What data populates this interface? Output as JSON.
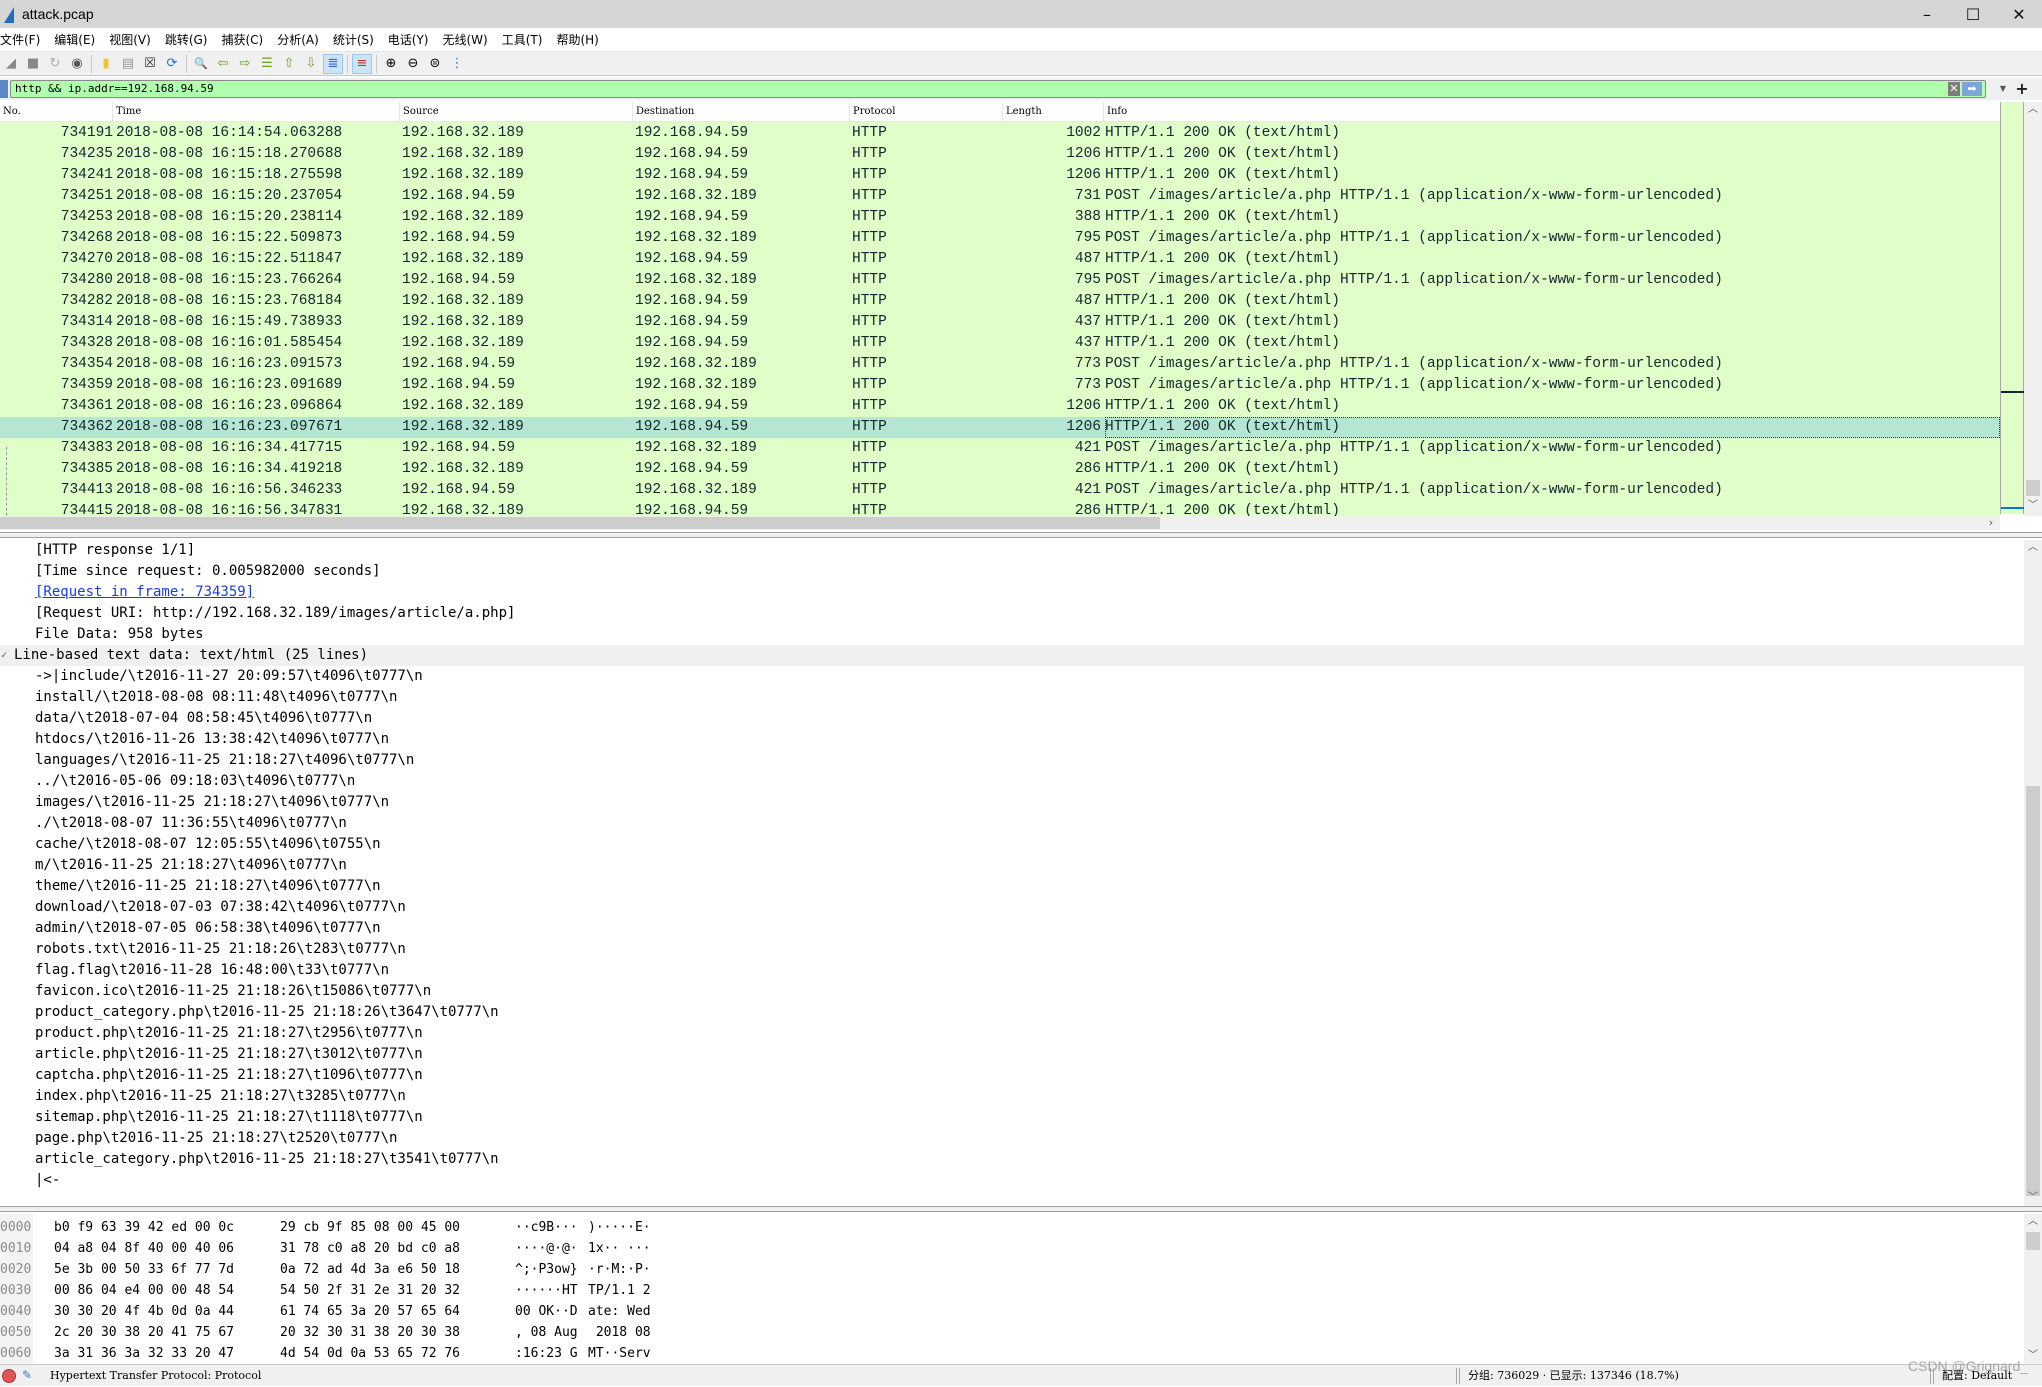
{
  "window": {
    "title": "attack.pcap",
    "controls": {
      "minimize": "–",
      "maximize": "☐",
      "close": "✕"
    }
  },
  "menu": [
    "文件(F)",
    "编辑(E)",
    "视图(V)",
    "跳转(G)",
    "捕获(C)",
    "分析(A)",
    "统计(S)",
    "电话(Y)",
    "无线(W)",
    "工具(T)",
    "帮助(H)"
  ],
  "toolbar": {
    "icons": [
      {
        "name": "start-capture-icon",
        "glyph": "◢"
      },
      {
        "name": "stop-capture-icon",
        "glyph": "■"
      },
      {
        "name": "restart-capture-icon",
        "glyph": "↻"
      },
      {
        "name": "capture-options-icon",
        "glyph": "◉"
      },
      {
        "name": "open-file-icon",
        "glyph": "▮"
      },
      {
        "name": "save-file-icon",
        "glyph": "▤"
      },
      {
        "name": "close-file-icon",
        "glyph": "☒"
      },
      {
        "name": "reload-file-icon",
        "glyph": "⟳"
      },
      {
        "name": "find-packet-icon",
        "glyph": "🔍"
      },
      {
        "name": "go-back-icon",
        "glyph": "⇦"
      },
      {
        "name": "go-forward-icon",
        "glyph": "⇨"
      },
      {
        "name": "go-to-packet-icon",
        "glyph": "☰"
      },
      {
        "name": "go-first-icon",
        "glyph": "⇧"
      },
      {
        "name": "go-last-icon",
        "glyph": "⇩"
      },
      {
        "name": "auto-scroll-icon",
        "glyph": "≣"
      },
      {
        "name": "colorize-icon",
        "glyph": "≡"
      },
      {
        "name": "zoom-in-icon",
        "glyph": "⊕"
      },
      {
        "name": "zoom-out-icon",
        "glyph": "⊖"
      },
      {
        "name": "zoom-reset-icon",
        "glyph": "⊜"
      },
      {
        "name": "resize-columns-icon",
        "glyph": "⋮"
      }
    ]
  },
  "filter": {
    "value": "http && ip.addr==192.168.94.59",
    "clear_glyph": "✕",
    "apply_glyph": "➡",
    "dropdown_glyph": "▼",
    "add_glyph": "+",
    "color": "#afffaf"
  },
  "packet_list": {
    "columns": [
      "No.",
      "Time",
      "Source",
      "Destination",
      "Protocol",
      "Length",
      "Info"
    ],
    "rows": [
      {
        "no": "734191",
        "time": "2018-08-08 16:14:54.063288",
        "src": "192.168.32.189",
        "dst": "192.168.94.59",
        "proto": "HTTP",
        "len": "1002",
        "info": "HTTP/1.1 200 OK  (text/html)"
      },
      {
        "no": "734235",
        "time": "2018-08-08 16:15:18.270688",
        "src": "192.168.32.189",
        "dst": "192.168.94.59",
        "proto": "HTTP",
        "len": "1206",
        "info": "HTTP/1.1 200 OK  (text/html)"
      },
      {
        "no": "734241",
        "time": "2018-08-08 16:15:18.275598",
        "src": "192.168.32.189",
        "dst": "192.168.94.59",
        "proto": "HTTP",
        "len": "1206",
        "info": "HTTP/1.1 200 OK  (text/html)"
      },
      {
        "no": "734251",
        "time": "2018-08-08 16:15:20.237054",
        "src": "192.168.94.59",
        "dst": "192.168.32.189",
        "proto": "HTTP",
        "len": "731",
        "info": "POST /images/article/a.php HTTP/1.1  (application/x-www-form-urlencoded)"
      },
      {
        "no": "734253",
        "time": "2018-08-08 16:15:20.238114",
        "src": "192.168.32.189",
        "dst": "192.168.94.59",
        "proto": "HTTP",
        "len": "388",
        "info": "HTTP/1.1 200 OK  (text/html)"
      },
      {
        "no": "734268",
        "time": "2018-08-08 16:15:22.509873",
        "src": "192.168.94.59",
        "dst": "192.168.32.189",
        "proto": "HTTP",
        "len": "795",
        "info": "POST /images/article/a.php HTTP/1.1  (application/x-www-form-urlencoded)"
      },
      {
        "no": "734270",
        "time": "2018-08-08 16:15:22.511847",
        "src": "192.168.32.189",
        "dst": "192.168.94.59",
        "proto": "HTTP",
        "len": "487",
        "info": "HTTP/1.1 200 OK  (text/html)"
      },
      {
        "no": "734280",
        "time": "2018-08-08 16:15:23.766264",
        "src": "192.168.94.59",
        "dst": "192.168.32.189",
        "proto": "HTTP",
        "len": "795",
        "info": "POST /images/article/a.php HTTP/1.1  (application/x-www-form-urlencoded)"
      },
      {
        "no": "734282",
        "time": "2018-08-08 16:15:23.768184",
        "src": "192.168.32.189",
        "dst": "192.168.94.59",
        "proto": "HTTP",
        "len": "487",
        "info": "HTTP/1.1 200 OK  (text/html)"
      },
      {
        "no": "734314",
        "time": "2018-08-08 16:15:49.738933",
        "src": "192.168.32.189",
        "dst": "192.168.94.59",
        "proto": "HTTP",
        "len": "437",
        "info": "HTTP/1.1 200 OK  (text/html)"
      },
      {
        "no": "734328",
        "time": "2018-08-08 16:16:01.585454",
        "src": "192.168.32.189",
        "dst": "192.168.94.59",
        "proto": "HTTP",
        "len": "437",
        "info": "HTTP/1.1 200 OK  (text/html)"
      },
      {
        "no": "734354",
        "time": "2018-08-08 16:16:23.091573",
        "src": "192.168.94.59",
        "dst": "192.168.32.189",
        "proto": "HTTP",
        "len": "773",
        "info": "POST /images/article/a.php HTTP/1.1  (application/x-www-form-urlencoded)"
      },
      {
        "no": "734359",
        "time": "2018-08-08 16:16:23.091689",
        "src": "192.168.94.59",
        "dst": "192.168.32.189",
        "proto": "HTTP",
        "len": "773",
        "info": "POST /images/article/a.php HTTP/1.1  (application/x-www-form-urlencoded)"
      },
      {
        "no": "734361",
        "time": "2018-08-08 16:16:23.096864",
        "src": "192.168.32.189",
        "dst": "192.168.94.59",
        "proto": "HTTP",
        "len": "1206",
        "info": "HTTP/1.1 200 OK  (text/html)"
      },
      {
        "no": "734362",
        "time": "2018-08-08 16:16:23.097671",
        "src": "192.168.32.189",
        "dst": "192.168.94.59",
        "proto": "HTTP",
        "len": "1206",
        "info": "HTTP/1.1 200 OK  (text/html)",
        "selected": true
      },
      {
        "no": "734383",
        "time": "2018-08-08 16:16:34.417715",
        "src": "192.168.94.59",
        "dst": "192.168.32.189",
        "proto": "HTTP",
        "len": "421",
        "info": "POST /images/article/a.php HTTP/1.1  (application/x-www-form-urlencoded)"
      },
      {
        "no": "734385",
        "time": "2018-08-08 16:16:34.419218",
        "src": "192.168.32.189",
        "dst": "192.168.94.59",
        "proto": "HTTP",
        "len": "286",
        "info": "HTTP/1.1 200 OK  (text/html)"
      },
      {
        "no": "734413",
        "time": "2018-08-08 16:16:56.346233",
        "src": "192.168.94.59",
        "dst": "192.168.32.189",
        "proto": "HTTP",
        "len": "421",
        "info": "POST /images/article/a.php HTTP/1.1  (application/x-www-form-urlencoded)"
      },
      {
        "no": "734415",
        "time": "2018-08-08 16:16:56.347831",
        "src": "192.168.32.189",
        "dst": "192.168.94.59",
        "proto": "HTTP",
        "len": "286",
        "info": "HTTP/1.1 200 OK  (text/html)"
      }
    ],
    "row_color": "#e0ffc8",
    "selected_color": "#b4e6d2"
  },
  "details": {
    "lines": [
      {
        "text": "[HTTP response 1/1]"
      },
      {
        "text": "[Time since request: 0.005982000 seconds]"
      },
      {
        "text": "[Request in frame: 734359]",
        "link": true
      },
      {
        "text": "[Request URI: http://192.168.32.189/images/article/a.php]"
      },
      {
        "text": "File Data: 958 bytes"
      },
      {
        "text": "Line-based text data: text/html (25 lines)",
        "header": true,
        "toggle": "✓"
      },
      {
        "text": "->|include/\\t2016-11-27 20:09:57\\t4096\\t0777\\n"
      },
      {
        "text": "install/\\t2018-08-08 08:11:48\\t4096\\t0777\\n"
      },
      {
        "text": "data/\\t2018-07-04 08:58:45\\t4096\\t0777\\n"
      },
      {
        "text": "htdocs/\\t2016-11-26 13:38:42\\t4096\\t0777\\n"
      },
      {
        "text": "languages/\\t2016-11-25 21:18:27\\t4096\\t0777\\n"
      },
      {
        "text": "../\\t2016-05-06 09:18:03\\t4096\\t0777\\n"
      },
      {
        "text": "images/\\t2016-11-25 21:18:27\\t4096\\t0777\\n"
      },
      {
        "text": "./\\t2018-08-07 11:36:55\\t4096\\t0777\\n"
      },
      {
        "text": "cache/\\t2018-08-07 12:05:55\\t4096\\t0755\\n"
      },
      {
        "text": "m/\\t2016-11-25 21:18:27\\t4096\\t0777\\n"
      },
      {
        "text": "theme/\\t2016-11-25 21:18:27\\t4096\\t0777\\n"
      },
      {
        "text": "download/\\t2018-07-03 07:38:42\\t4096\\t0777\\n"
      },
      {
        "text": "admin/\\t2018-07-05 06:58:38\\t4096\\t0777\\n"
      },
      {
        "text": "robots.txt\\t2016-11-25 21:18:26\\t283\\t0777\\n"
      },
      {
        "text": "flag.flag\\t2016-11-28 16:48:00\\t33\\t0777\\n"
      },
      {
        "text": "favicon.ico\\t2016-11-25 21:18:26\\t15086\\t0777\\n"
      },
      {
        "text": "product_category.php\\t2016-11-25 21:18:26\\t3647\\t0777\\n"
      },
      {
        "text": "product.php\\t2016-11-25 21:18:27\\t2956\\t0777\\n"
      },
      {
        "text": "article.php\\t2016-11-25 21:18:27\\t3012\\t0777\\n"
      },
      {
        "text": "captcha.php\\t2016-11-25 21:18:27\\t1096\\t0777\\n"
      },
      {
        "text": "index.php\\t2016-11-25 21:18:27\\t3285\\t0777\\n"
      },
      {
        "text": "sitemap.php\\t2016-11-25 21:18:27\\t1118\\t0777\\n"
      },
      {
        "text": "page.php\\t2016-11-25 21:18:27\\t2520\\t0777\\n"
      },
      {
        "text": "article_category.php\\t2016-11-25 21:18:27\\t3541\\t0777\\n"
      },
      {
        "text": "|<-"
      }
    ]
  },
  "bytes": {
    "rows": [
      {
        "off": "0000",
        "hex1": "b0 f9 63 39 42 ed 00 0c",
        "hex2": "29 cb 9f 85 08 00 45 00",
        "asc1": "··c9B···",
        "asc2": ")·····E·"
      },
      {
        "off": "0010",
        "hex1": "04 a8 04 8f 40 00 40 06",
        "hex2": "31 78 c0 a8 20 bd c0 a8",
        "asc1": "····@·@·",
        "asc2": "1x·· ···"
      },
      {
        "off": "0020",
        "hex1": "5e 3b 00 50 33 6f 77 7d",
        "hex2": "0a 72 ad 4d 3a e6 50 18",
        "asc1": "^;·P3ow}",
        "asc2": "·r·M:·P·"
      },
      {
        "off": "0030",
        "hex1": "00 86 04 e4 00 00 48 54",
        "hex2": "54 50 2f 31 2e 31 20 32",
        "asc1": "······HT",
        "asc2": "TP/1.1 2"
      },
      {
        "off": "0040",
        "hex1": "30 30 20 4f 4b 0d 0a 44",
        "hex2": "61 74 65 3a 20 57 65 64",
        "asc1": "00 OK··D",
        "asc2": "ate: Wed"
      },
      {
        "off": "0050",
        "hex1": "2c 20 30 38 20 41 75 67",
        "hex2": "20 32 30 31 38 20 30 38",
        "asc1": ", 08 Aug",
        "asc2": " 2018 08"
      },
      {
        "off": "0060",
        "hex1": "3a 31 36 3a 32 33 20 47",
        "hex2": "4d 54 0d 0a 53 65 72 76",
        "asc1": ":16:23 G",
        "asc2": "MT··Serv"
      }
    ]
  },
  "status": {
    "field_text": "Hypertext Transfer Protocol: Protocol",
    "counts": "分组: 736029 · 已显示: 137346 (18.7%)",
    "profile": "配置: Default",
    "watermark": "CSDN @Grignard_"
  }
}
